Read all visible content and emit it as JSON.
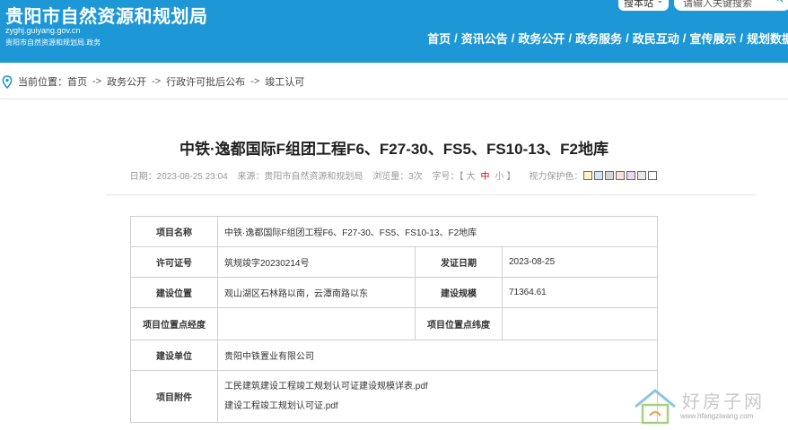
{
  "header": {
    "site_title": "贵阳市自然资源和规划局",
    "domain": "zyghj.guiyang.gov.cn",
    "subtitle": "贵阳市自然资源和规划局.政务",
    "search_scope": "搜本站",
    "search_placeholder": "请输入关键搜索",
    "nav": [
      "首页",
      "资讯公告",
      "政务公开",
      "政务服务",
      "政民互动",
      "宣传展示",
      "规划数据"
    ]
  },
  "breadcrumb": {
    "label": "当前位置：",
    "items": [
      "首页",
      "政务公开",
      "行政许可批后公布",
      "竣工认可"
    ],
    "sep": "->"
  },
  "article": {
    "title": "中铁·逸都国际F组团工程F6、F27-30、FS5、FS10-13、F2地库",
    "date": "日期：2023-08-25 23:04",
    "source": "来源：贵阳市自然资源和规划局",
    "views": "浏览量：3次",
    "font_label": "字号：【",
    "font_large": "大",
    "font_mid": "中",
    "font_small": "小",
    "font_end": "】",
    "eye_label": "视力保护色："
  },
  "colors": {
    "header_bg": "#1d97d5",
    "swatches": [
      "#fdf5c8",
      "#cfe8f5",
      "#d7d7d7",
      "#fbe0e0",
      "#efd8ef",
      "#e8e8e8",
      "#ffffff"
    ]
  },
  "table": {
    "project_name_label": "项目名称",
    "project_name": "中铁·逸都国际F组团工程F6、F27-30、FS5、FS10-13、F2地库",
    "permit_label": "许可证号",
    "permit": "筑规竣字20230214号",
    "issue_date_label": "发证日期",
    "issue_date": "2023-08-25",
    "location_label": "建设位置",
    "location": "观山湖区石林路以南，云潭南路以东",
    "scale_label": "建设规模",
    "scale": "71364.61",
    "lng_label": "项目位置点经度",
    "lat_label": "项目位置点纬度",
    "unit_label": "建设单位",
    "unit": "贵阳中铁置业有限公司",
    "attach_label": "项目附件",
    "attachments": [
      "工民建筑建设工程竣工规划认可证建设规模详表.pdf",
      "建设工程竣工规划认可证.pdf"
    ]
  },
  "watermark": {
    "text": "好房子网",
    "url": "www.hfangziwang.com"
  }
}
